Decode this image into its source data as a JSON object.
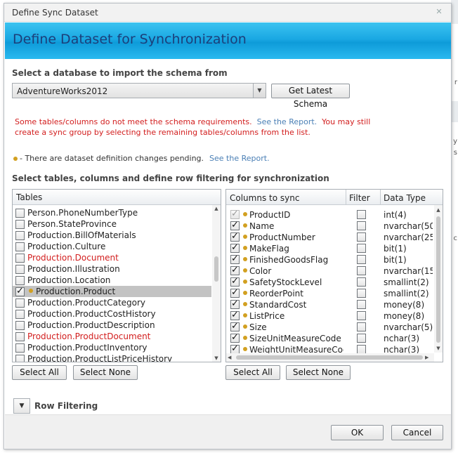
{
  "window": {
    "title": "Define Sync Dataset",
    "close_icon": "close-icon"
  },
  "header": {
    "title": "Define Dataset for Synchronization"
  },
  "database": {
    "label": "Select a database to import the schema from",
    "selected": "AdventureWorks2012",
    "get_schema_label": "Get Latest Schema"
  },
  "warning": {
    "text1": "Some tables/columns do not meet the schema requirements.",
    "link": "See the Report.",
    "text2": "You may still create a sync group by selecting the remaining tables/columns from the list."
  },
  "pending": {
    "text": "- There are dataset definition changes pending.",
    "link": "See the Report."
  },
  "select_label": "Select tables, columns and define row filtering for synchronization",
  "tables": {
    "header": "Tables",
    "items": [
      {
        "name": "Person.PhoneNumberType",
        "checked": false,
        "error": false,
        "pending": false,
        "selected": false
      },
      {
        "name": "Person.StateProvince",
        "checked": false,
        "error": false,
        "pending": false,
        "selected": false
      },
      {
        "name": "Production.BillOfMaterials",
        "checked": false,
        "error": false,
        "pending": false,
        "selected": false
      },
      {
        "name": "Production.Culture",
        "checked": false,
        "error": false,
        "pending": false,
        "selected": false
      },
      {
        "name": "Production.Document",
        "checked": false,
        "error": true,
        "pending": false,
        "selected": false
      },
      {
        "name": "Production.Illustration",
        "checked": false,
        "error": false,
        "pending": false,
        "selected": false
      },
      {
        "name": "Production.Location",
        "checked": false,
        "error": false,
        "pending": false,
        "selected": false
      },
      {
        "name": "Production.Product",
        "checked": true,
        "error": false,
        "pending": true,
        "selected": true
      },
      {
        "name": "Production.ProductCategory",
        "checked": false,
        "error": false,
        "pending": false,
        "selected": false
      },
      {
        "name": "Production.ProductCostHistory",
        "checked": false,
        "error": false,
        "pending": false,
        "selected": false
      },
      {
        "name": "Production.ProductDescription",
        "checked": false,
        "error": false,
        "pending": false,
        "selected": false
      },
      {
        "name": "Production.ProductDocument",
        "checked": false,
        "error": true,
        "pending": false,
        "selected": false
      },
      {
        "name": "Production.ProductInventory",
        "checked": false,
        "error": false,
        "pending": false,
        "selected": false
      },
      {
        "name": "Production.ProductListPriceHistory",
        "checked": false,
        "error": false,
        "pending": false,
        "selected": false
      }
    ],
    "select_all": "Select All",
    "select_none": "Select None"
  },
  "columns": {
    "headers": {
      "name": "Columns to sync",
      "filter": "Filter",
      "type": "Data Type"
    },
    "items": [
      {
        "name": "ProductID",
        "type": "int(4)",
        "checked": true,
        "locked": true
      },
      {
        "name": "Name",
        "type": "nvarchar(50",
        "checked": true,
        "locked": false
      },
      {
        "name": "ProductNumber",
        "type": "nvarchar(25",
        "checked": true,
        "locked": false
      },
      {
        "name": "MakeFlag",
        "type": "bit(1)",
        "checked": true,
        "locked": false
      },
      {
        "name": "FinishedGoodsFlag",
        "type": "bit(1)",
        "checked": true,
        "locked": false
      },
      {
        "name": "Color",
        "type": "nvarchar(15",
        "checked": true,
        "locked": false
      },
      {
        "name": "SafetyStockLevel",
        "type": "smallint(2)",
        "checked": true,
        "locked": false
      },
      {
        "name": "ReorderPoint",
        "type": "smallint(2)",
        "checked": true,
        "locked": false
      },
      {
        "name": "StandardCost",
        "type": "money(8)",
        "checked": true,
        "locked": false
      },
      {
        "name": "ListPrice",
        "type": "money(8)",
        "checked": true,
        "locked": false
      },
      {
        "name": "Size",
        "type": "nvarchar(5)",
        "checked": true,
        "locked": false
      },
      {
        "name": "SizeUnitMeasureCode",
        "type": "nchar(3)",
        "checked": true,
        "locked": false
      },
      {
        "name": "WeightUnitMeasureCode",
        "type": "nchar(3)",
        "checked": true,
        "locked": false
      }
    ],
    "select_all": "Select All",
    "select_none": "Select None"
  },
  "row_filtering": {
    "label": "Row Filtering"
  },
  "footer": {
    "ok": "OK",
    "cancel": "Cancel"
  },
  "background": {
    "frag1": "r",
    "frag2": "y",
    "frag3": "s",
    "frag4": "c"
  },
  "colors": {
    "accent": "#1aa8e3",
    "error": "#d21d1d",
    "link": "#4a7fb5",
    "pending_dot": "#d2a020"
  }
}
